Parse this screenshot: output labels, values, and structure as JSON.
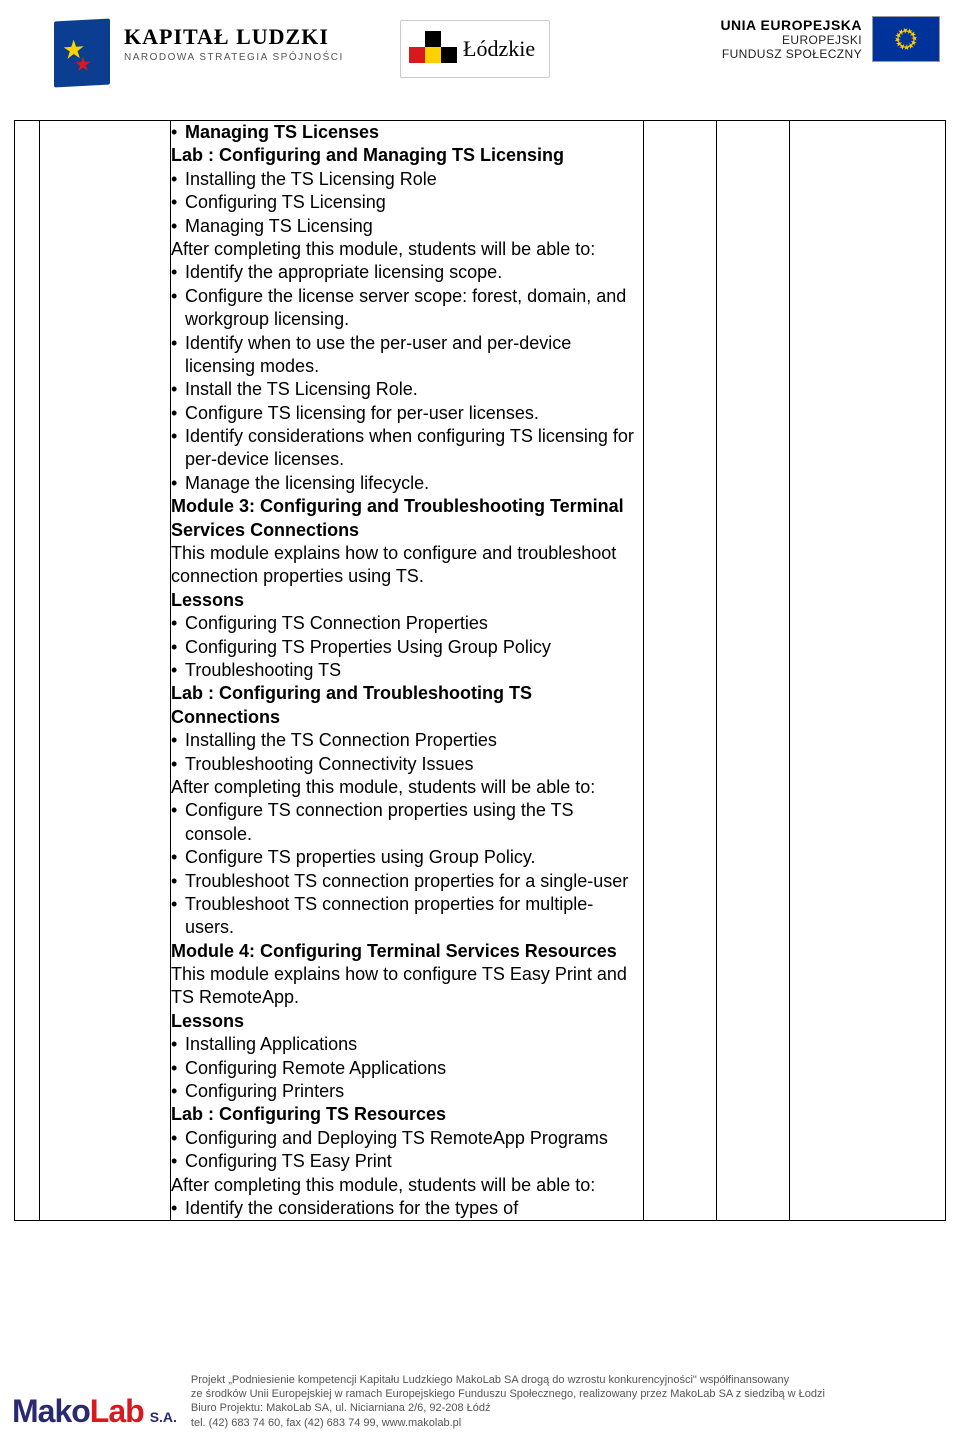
{
  "header": {
    "kapital_title": "KAPITAŁ LUDZKI",
    "kapital_sub": "NARODOWA STRATEGIA SPÓJNOŚCI",
    "lodzkie": "Łódzkie",
    "eu_line1": "UNIA EUROPEJSKA",
    "eu_line2": "EUROPEJSKI",
    "eu_line3": "FUNDUSZ SPOŁECZNY"
  },
  "content": {
    "l01_b": "Managing TS Licenses",
    "l02_b": "Lab : Configuring and Managing TS Licensing",
    "l03": "Installing the TS Licensing Role",
    "l04": "Configuring TS Licensing",
    "l05": "Managing TS Licensing",
    "l06": "After completing this module, students will be able to:",
    "l07": "Identify the appropriate licensing scope.",
    "l08": "Configure the license server scope: forest, domain, and workgroup licensing.",
    "l09": "Identify when to use the per-user and per-device licensing modes.",
    "l10": "Install the TS Licensing Role.",
    "l11": "Configure TS licensing for per-user licenses.",
    "l12": "Identify considerations when configuring TS licensing for per-device licenses.",
    "l13": "Manage the licensing lifecycle.",
    "l14_b": "Module 3: Configuring and Troubleshooting Terminal Services Connections",
    "l15": "This module explains how to configure and troubleshoot connection properties using TS.",
    "l16_b": "Lessons",
    "l17": "Configuring TS Connection Properties",
    "l18": "Configuring TS Properties Using Group Policy",
    "l19": "Troubleshooting TS",
    "l20_b": "Lab : Configuring and Troubleshooting TS Connections",
    "l21": "Installing the TS Connection Properties",
    "l22": "Troubleshooting Connectivity Issues",
    "l23": "After completing this module, students will be able to:",
    "l24": "Configure TS connection properties using the TS console.",
    "l25": "Configure TS properties using Group Policy.",
    "l26": "Troubleshoot TS connection properties for a single-user",
    "l27": "Troubleshoot TS connection properties for multiple- users.",
    "l28_b": "Module 4: Configuring Terminal Services Resources",
    "l29": "This module explains how to configure TS Easy Print and TS RemoteApp.",
    "l30_b": "Lessons",
    "l31": "Installing Applications",
    "l32": "Configuring Remote Applications",
    "l33": "Configuring Printers",
    "l34_b": "Lab : Configuring TS Resources",
    "l35": "Configuring and Deploying TS RemoteApp Programs",
    "l36": "Configuring TS Easy Print",
    "l37": "After completing this module, students will be able to:",
    "l38": "Identify the considerations for the types of"
  },
  "footer": {
    "brand": "MakoLab",
    "brand_suffix": "S.A.",
    "line1": "Projekt „Podniesienie kompetencji Kapitału Ludzkiego MakoLab SA drogą do wzrostu konkurencyjności\" współfinansowany",
    "line2": "ze środków Unii Europejskiej w ramach Europejskiego Funduszu Społecznego, realizowany przez MakoLab SA z siedzibą w Łodzi",
    "line3": "Biuro Projektu: MakoLab SA, ul. Niciarniana 2/6, 92-208 Łódź",
    "line4": "tel. (42) 683 74 60,  fax (42) 683 74 99, www.makolab.pl"
  }
}
